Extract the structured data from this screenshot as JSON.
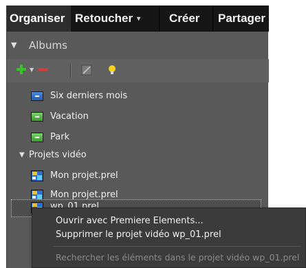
{
  "tabs": [
    {
      "label": "Organiser"
    },
    {
      "label": "Retoucher"
    },
    {
      "label": "Créer"
    },
    {
      "label": "Partager"
    }
  ],
  "albums_header": {
    "label": "Albums"
  },
  "toolbar": {
    "add_icon": "plus-icon",
    "remove_icon": "minus-icon",
    "edit_icon": "edit-icon",
    "tip_icon": "lightbulb-icon"
  },
  "albums": [
    {
      "label": "Six derniers mois",
      "icon_color": "#3a74cf"
    },
    {
      "label": "Vacation",
      "icon_color": "#55b346"
    },
    {
      "label": "Park",
      "icon_color": "#55b346"
    }
  ],
  "video_folder": {
    "label": "Projets vidéo"
  },
  "projects": [
    {
      "label": "Mon projet.prel"
    },
    {
      "label": "Mon projet.prel"
    },
    {
      "label": "wp_01.prel"
    }
  ],
  "context_menu": {
    "items": [
      {
        "label": "Ouvrir avec Premiere Elements...",
        "enabled": true
      },
      {
        "label": "Supprimer le projet vidéo wp_01.prel",
        "enabled": true
      },
      {
        "label": "Rechercher les éléments dans le projet vidéo wp_01.prel",
        "enabled": false
      }
    ]
  },
  "colors": {
    "panel_bg": "#595959",
    "tabbar_bg": "#161616",
    "menu_bg": "#3b3b3b",
    "add_green": "#37c22b",
    "remove_red": "#d43b3b"
  }
}
